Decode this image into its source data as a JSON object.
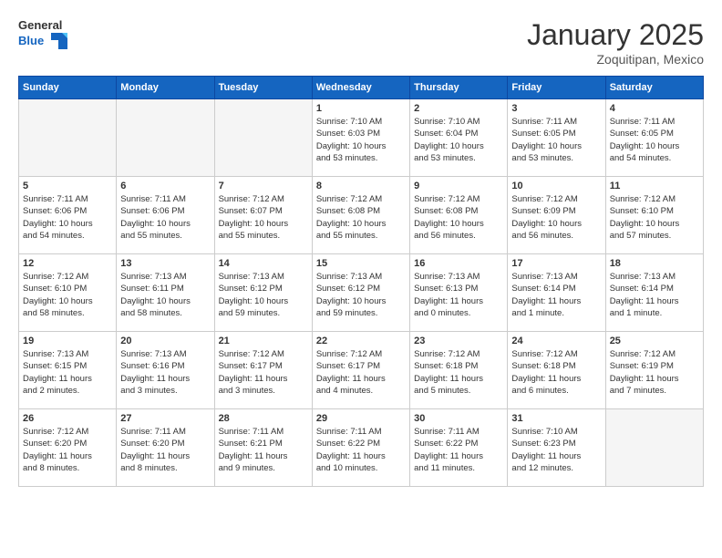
{
  "header": {
    "logo_line1": "General",
    "logo_line2": "Blue",
    "month_title": "January 2025",
    "location": "Zoquitipan, Mexico"
  },
  "days_of_week": [
    "Sunday",
    "Monday",
    "Tuesday",
    "Wednesday",
    "Thursday",
    "Friday",
    "Saturday"
  ],
  "weeks": [
    [
      {
        "day": "",
        "info": ""
      },
      {
        "day": "",
        "info": ""
      },
      {
        "day": "",
        "info": ""
      },
      {
        "day": "1",
        "info": "Sunrise: 7:10 AM\nSunset: 6:03 PM\nDaylight: 10 hours\nand 53 minutes."
      },
      {
        "day": "2",
        "info": "Sunrise: 7:10 AM\nSunset: 6:04 PM\nDaylight: 10 hours\nand 53 minutes."
      },
      {
        "day": "3",
        "info": "Sunrise: 7:11 AM\nSunset: 6:05 PM\nDaylight: 10 hours\nand 53 minutes."
      },
      {
        "day": "4",
        "info": "Sunrise: 7:11 AM\nSunset: 6:05 PM\nDaylight: 10 hours\nand 54 minutes."
      }
    ],
    [
      {
        "day": "5",
        "info": "Sunrise: 7:11 AM\nSunset: 6:06 PM\nDaylight: 10 hours\nand 54 minutes."
      },
      {
        "day": "6",
        "info": "Sunrise: 7:11 AM\nSunset: 6:06 PM\nDaylight: 10 hours\nand 55 minutes."
      },
      {
        "day": "7",
        "info": "Sunrise: 7:12 AM\nSunset: 6:07 PM\nDaylight: 10 hours\nand 55 minutes."
      },
      {
        "day": "8",
        "info": "Sunrise: 7:12 AM\nSunset: 6:08 PM\nDaylight: 10 hours\nand 55 minutes."
      },
      {
        "day": "9",
        "info": "Sunrise: 7:12 AM\nSunset: 6:08 PM\nDaylight: 10 hours\nand 56 minutes."
      },
      {
        "day": "10",
        "info": "Sunrise: 7:12 AM\nSunset: 6:09 PM\nDaylight: 10 hours\nand 56 minutes."
      },
      {
        "day": "11",
        "info": "Sunrise: 7:12 AM\nSunset: 6:10 PM\nDaylight: 10 hours\nand 57 minutes."
      }
    ],
    [
      {
        "day": "12",
        "info": "Sunrise: 7:12 AM\nSunset: 6:10 PM\nDaylight: 10 hours\nand 58 minutes."
      },
      {
        "day": "13",
        "info": "Sunrise: 7:13 AM\nSunset: 6:11 PM\nDaylight: 10 hours\nand 58 minutes."
      },
      {
        "day": "14",
        "info": "Sunrise: 7:13 AM\nSunset: 6:12 PM\nDaylight: 10 hours\nand 59 minutes."
      },
      {
        "day": "15",
        "info": "Sunrise: 7:13 AM\nSunset: 6:12 PM\nDaylight: 10 hours\nand 59 minutes."
      },
      {
        "day": "16",
        "info": "Sunrise: 7:13 AM\nSunset: 6:13 PM\nDaylight: 11 hours\nand 0 minutes."
      },
      {
        "day": "17",
        "info": "Sunrise: 7:13 AM\nSunset: 6:14 PM\nDaylight: 11 hours\nand 1 minute."
      },
      {
        "day": "18",
        "info": "Sunrise: 7:13 AM\nSunset: 6:14 PM\nDaylight: 11 hours\nand 1 minute."
      }
    ],
    [
      {
        "day": "19",
        "info": "Sunrise: 7:13 AM\nSunset: 6:15 PM\nDaylight: 11 hours\nand 2 minutes."
      },
      {
        "day": "20",
        "info": "Sunrise: 7:13 AM\nSunset: 6:16 PM\nDaylight: 11 hours\nand 3 minutes."
      },
      {
        "day": "21",
        "info": "Sunrise: 7:12 AM\nSunset: 6:17 PM\nDaylight: 11 hours\nand 3 minutes."
      },
      {
        "day": "22",
        "info": "Sunrise: 7:12 AM\nSunset: 6:17 PM\nDaylight: 11 hours\nand 4 minutes."
      },
      {
        "day": "23",
        "info": "Sunrise: 7:12 AM\nSunset: 6:18 PM\nDaylight: 11 hours\nand 5 minutes."
      },
      {
        "day": "24",
        "info": "Sunrise: 7:12 AM\nSunset: 6:18 PM\nDaylight: 11 hours\nand 6 minutes."
      },
      {
        "day": "25",
        "info": "Sunrise: 7:12 AM\nSunset: 6:19 PM\nDaylight: 11 hours\nand 7 minutes."
      }
    ],
    [
      {
        "day": "26",
        "info": "Sunrise: 7:12 AM\nSunset: 6:20 PM\nDaylight: 11 hours\nand 8 minutes."
      },
      {
        "day": "27",
        "info": "Sunrise: 7:11 AM\nSunset: 6:20 PM\nDaylight: 11 hours\nand 8 minutes."
      },
      {
        "day": "28",
        "info": "Sunrise: 7:11 AM\nSunset: 6:21 PM\nDaylight: 11 hours\nand 9 minutes."
      },
      {
        "day": "29",
        "info": "Sunrise: 7:11 AM\nSunset: 6:22 PM\nDaylight: 11 hours\nand 10 minutes."
      },
      {
        "day": "30",
        "info": "Sunrise: 7:11 AM\nSunset: 6:22 PM\nDaylight: 11 hours\nand 11 minutes."
      },
      {
        "day": "31",
        "info": "Sunrise: 7:10 AM\nSunset: 6:23 PM\nDaylight: 11 hours\nand 12 minutes."
      },
      {
        "day": "",
        "info": ""
      }
    ]
  ]
}
